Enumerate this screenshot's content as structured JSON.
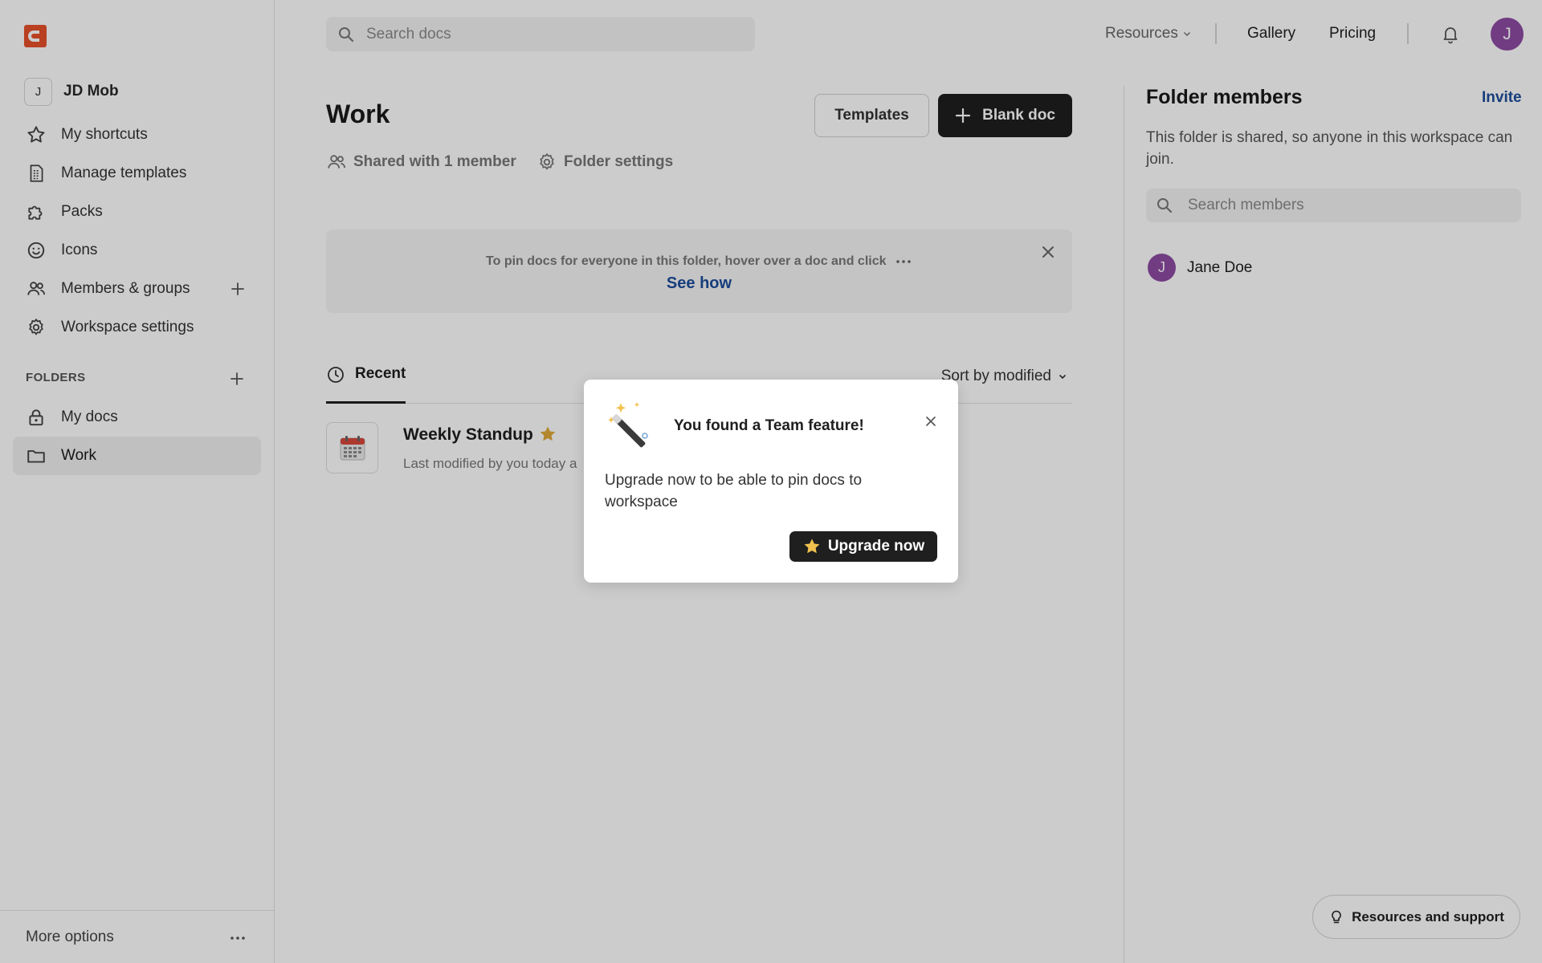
{
  "workspace": {
    "initial": "J",
    "name": "JD Mob"
  },
  "sidebar": {
    "nav": [
      {
        "label": "My shortcuts",
        "icon": "star-outline-icon"
      },
      {
        "label": "Manage templates",
        "icon": "template-icon"
      },
      {
        "label": "Packs",
        "icon": "puzzle-icon"
      },
      {
        "label": "Icons",
        "icon": "smiley-icon"
      },
      {
        "label": "Members & groups",
        "icon": "people-icon"
      },
      {
        "label": "Workspace settings",
        "icon": "gear-icon"
      }
    ],
    "folders_label": "FOLDERS",
    "folders": [
      {
        "label": "My docs",
        "icon": "lock-icon"
      },
      {
        "label": "Work",
        "icon": "folder-icon",
        "active": true
      }
    ],
    "more_options": "More options"
  },
  "topbar": {
    "search_placeholder": "Search docs",
    "resources": "Resources",
    "gallery": "Gallery",
    "pricing": "Pricing",
    "user_initial": "J"
  },
  "main": {
    "title": "Work",
    "templates_button": "Templates",
    "blank_doc_button": "Blank doc",
    "shared_with": "Shared with 1 member",
    "folder_settings": "Folder settings",
    "pin_banner": {
      "text": "To pin docs for everyone in this folder, hover over a doc and click",
      "link": "See how"
    },
    "tab_recent": "Recent",
    "sort_label": "Sort by modified",
    "docs": [
      {
        "title": "Weekly Standup",
        "subtitle": "Last modified by you today a",
        "starred": true
      }
    ]
  },
  "right_panel": {
    "title": "Folder members",
    "invite": "Invite",
    "description": "This folder is shared, so anyone in this workspace can join.",
    "search_placeholder": "Search members",
    "members": [
      {
        "initial": "J",
        "name": "Jane Doe"
      }
    ],
    "support_button": "Resources and support"
  },
  "popup": {
    "title": "You found a Team feature!",
    "body": "Upgrade now to be able to pin docs to workspace",
    "button": "Upgrade now"
  },
  "colors": {
    "brand": "#e8512a",
    "avatar": "#8e4ba3",
    "link": "#1c4d9c",
    "dark_button": "#1f1f1f",
    "star": "#e0a93a"
  }
}
